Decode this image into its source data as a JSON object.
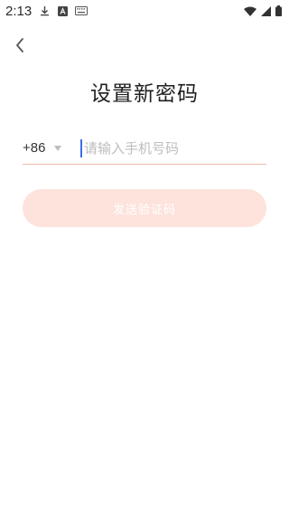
{
  "status_bar": {
    "time": "2:13",
    "left_icons": [
      "download-icon",
      "a-badge-icon",
      "keyboard-icon"
    ],
    "right_icons": [
      "wifi-icon",
      "signal-icon",
      "battery-icon"
    ]
  },
  "header": {
    "back_icon": "chevron-left-icon"
  },
  "title": "设置新密码",
  "phone": {
    "country_code": "+86",
    "placeholder": "请输入手机号码",
    "value": ""
  },
  "send_button": {
    "label": "发送验证码",
    "enabled": false
  },
  "colors": {
    "accent_line": "#f2b9a9",
    "button_bg_disabled": "#fde3dc",
    "cursor": "#3b6fe6"
  }
}
